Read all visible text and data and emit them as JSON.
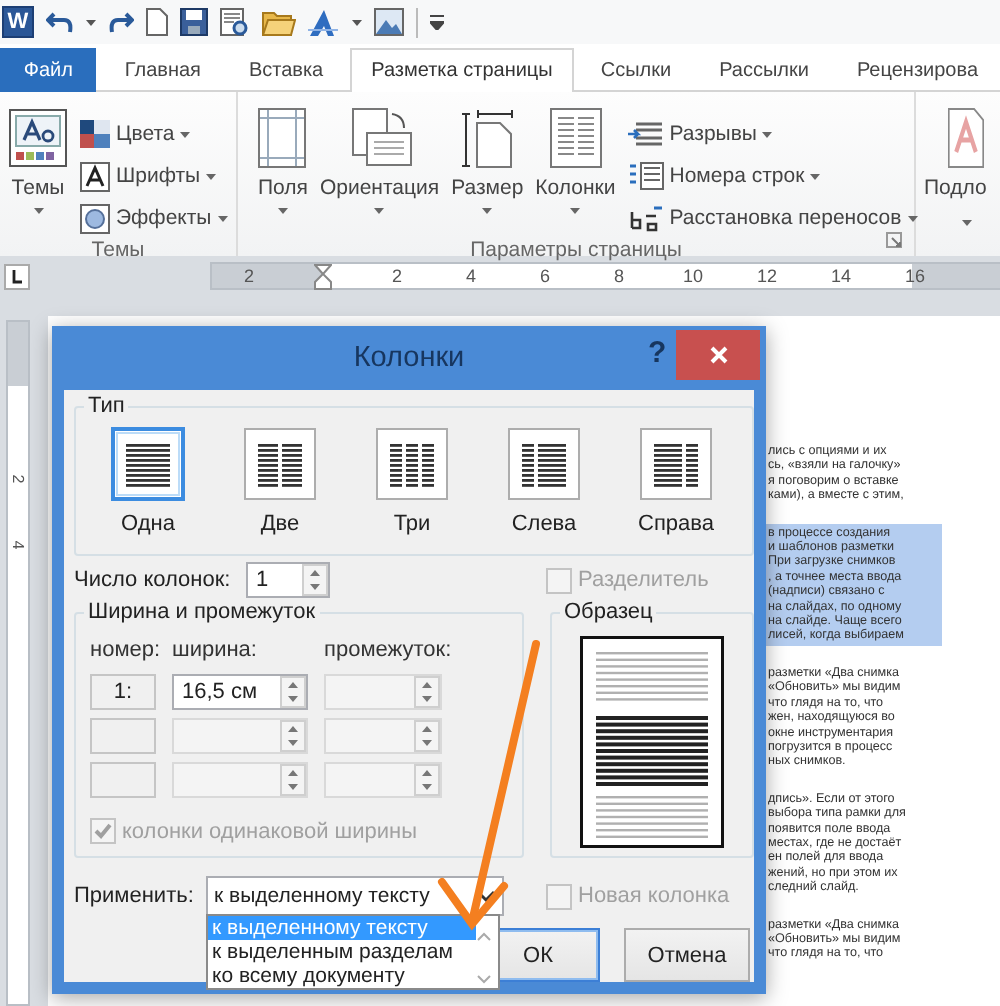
{
  "app_icon": "W",
  "tabs": [
    {
      "label": "Файл",
      "kind": "file",
      "selected": false
    },
    {
      "label": "Главная",
      "kind": "tab",
      "selected": false
    },
    {
      "label": "Вставка",
      "kind": "tab",
      "selected": false
    },
    {
      "label": "Разметка страницы",
      "kind": "tab",
      "selected": true
    },
    {
      "label": "Ссылки",
      "kind": "tab",
      "selected": false
    },
    {
      "label": "Рассылки",
      "kind": "tab",
      "selected": false
    },
    {
      "label": "Рецензирова",
      "kind": "tab",
      "selected": false
    }
  ],
  "ribbon": {
    "themes": {
      "button": "Темы",
      "label": "Темы",
      "items": [
        {
          "label": "Цвета",
          "kind": "colors"
        },
        {
          "label": "Шрифты",
          "kind": "fonts"
        },
        {
          "label": "Эффекты",
          "kind": "effects"
        }
      ]
    },
    "page_setup": {
      "label": "Параметры страницы",
      "buttons": [
        {
          "label": "Поля",
          "kind": "margins"
        },
        {
          "label": "Ориентация",
          "kind": "orientation"
        },
        {
          "label": "Размер",
          "kind": "size"
        },
        {
          "label": "Колонки",
          "kind": "columns"
        }
      ],
      "items": [
        {
          "label": "Разрывы",
          "kind": "breaks"
        },
        {
          "label": "Номера строк",
          "kind": "line_numbers"
        },
        {
          "label": "Расстановка переносов",
          "kind": "hyphenation"
        }
      ]
    },
    "background": {
      "button": "Подло"
    }
  },
  "ruler": {
    "left_marks": [
      "2"
    ],
    "right_marks": [
      "2",
      "4",
      "6",
      "8",
      "10",
      "12",
      "14",
      "16"
    ],
    "vertical_marks": [
      "2",
      "4"
    ]
  },
  "document": {
    "paragraphs": [
      {
        "highlighted": false,
        "lines": [
          "лись с опциями и их",
          "сь, «взяли на галочку»",
          "я поговорим о вставке",
          "ками), а вместе с этим,"
        ]
      },
      {
        "highlighted": true,
        "lines": [
          "в процессе создания",
          "и шаблонов разметки",
          "При загрузке снимков",
          ", а точнее места ввода",
          "(надписи) связано с",
          "на слайдах, по одному",
          "на слайде. Чаще всего",
          "лисей, когда выбираем"
        ]
      },
      {
        "highlighted": false,
        "lines": [
          "разметки «Два снимка",
          "«Обновить» мы видим",
          "что глядя на то, что",
          "жен, находящуюся во",
          "окне инструментария",
          "погрузится в процесс",
          "ных снимков."
        ]
      },
      {
        "highlighted": false,
        "lines": [
          "дпись». Если от этого",
          "выбора типа рамки для",
          "появится поле ввода",
          "местах, где не достаёт",
          "ен полей для ввода",
          "жений, но при этом их",
          "следний слайд."
        ]
      },
      {
        "highlighted": false,
        "lines": [
          "разметки «Два снимка",
          "«Обновить» мы видим",
          "что глядя на то, что"
        ]
      }
    ]
  },
  "dialog": {
    "title": "Колонки",
    "help": "?",
    "presets_group": {
      "label": "Тип",
      "presets": [
        {
          "label": "Одна",
          "kind": "one",
          "selected": true
        },
        {
          "label": "Две",
          "kind": "two",
          "selected": false
        },
        {
          "label": "Три",
          "kind": "three",
          "selected": false
        },
        {
          "label": "Слева",
          "kind": "left",
          "selected": false
        },
        {
          "label": "Справа",
          "kind": "right",
          "selected": false
        }
      ]
    },
    "count": {
      "label": "Число колонок:",
      "value": "1"
    },
    "separator": {
      "label": "Разделитель",
      "checked": false,
      "disabled": true
    },
    "widths_group": {
      "label": "Ширина и промежуток",
      "headers": [
        "номер:",
        "ширина:",
        "промежуток:"
      ],
      "rows": [
        {
          "number": "1:",
          "width": "16,5 см",
          "disabled": false,
          "spacing_disabled": true
        },
        {
          "disabled": true,
          "spacing_disabled": true
        },
        {
          "disabled": true,
          "spacing_disabled": true
        }
      ]
    },
    "equal_width": {
      "label": "колонки одинаковой ширины",
      "checked": true,
      "disabled": true
    },
    "preview_group": {
      "label": "Образец"
    },
    "apply": {
      "label": "Применить:",
      "value": "к выделенному тексту",
      "expanded": true,
      "options": [
        {
          "label": "к выделенному тексту",
          "selected": true
        },
        {
          "label": "к выделенным разделам",
          "selected": false
        },
        {
          "label": "ко всему документу",
          "selected": false
        }
      ]
    },
    "new_column": {
      "label": "Новая колонка",
      "checked": false,
      "disabled": true
    },
    "buttons": [
      {
        "label": "ОК",
        "kind": "default"
      },
      {
        "label": "Отмена",
        "kind": "normal"
      }
    ]
  }
}
